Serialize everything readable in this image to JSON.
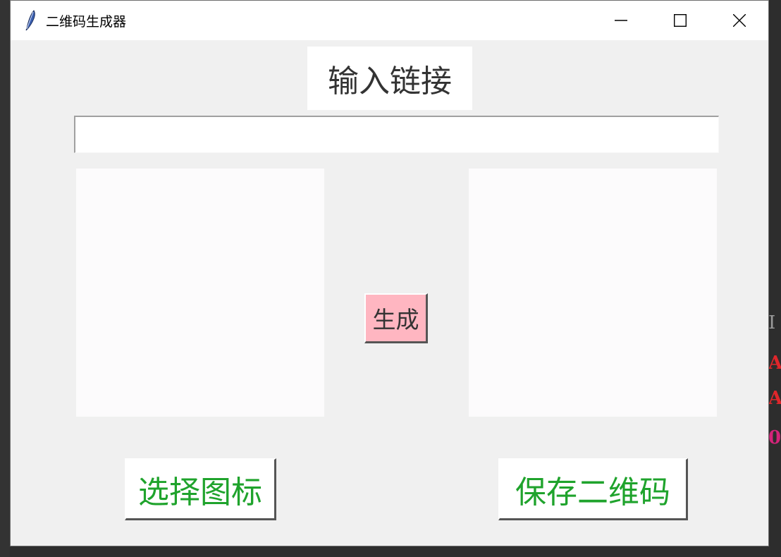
{
  "window": {
    "title": "二维码生成器",
    "controls": {
      "minimize": "minimize-icon",
      "maximize": "maximize-icon",
      "close": "close-icon"
    }
  },
  "main": {
    "heading": "输入链接",
    "url_input": {
      "value": "",
      "placeholder": ""
    },
    "generate_button": "生成",
    "select_icon_button": "选择图标",
    "save_qr_button": "保存二维码"
  },
  "background_editor": {
    "fragments": [
      "I",
      "A",
      "A",
      "0"
    ]
  },
  "colors": {
    "generate_button_bg": "#ffb6c1",
    "action_text": "#1fa32c",
    "window_bg": "#f0f0f0",
    "panel_bg": "#fcfbfc"
  }
}
